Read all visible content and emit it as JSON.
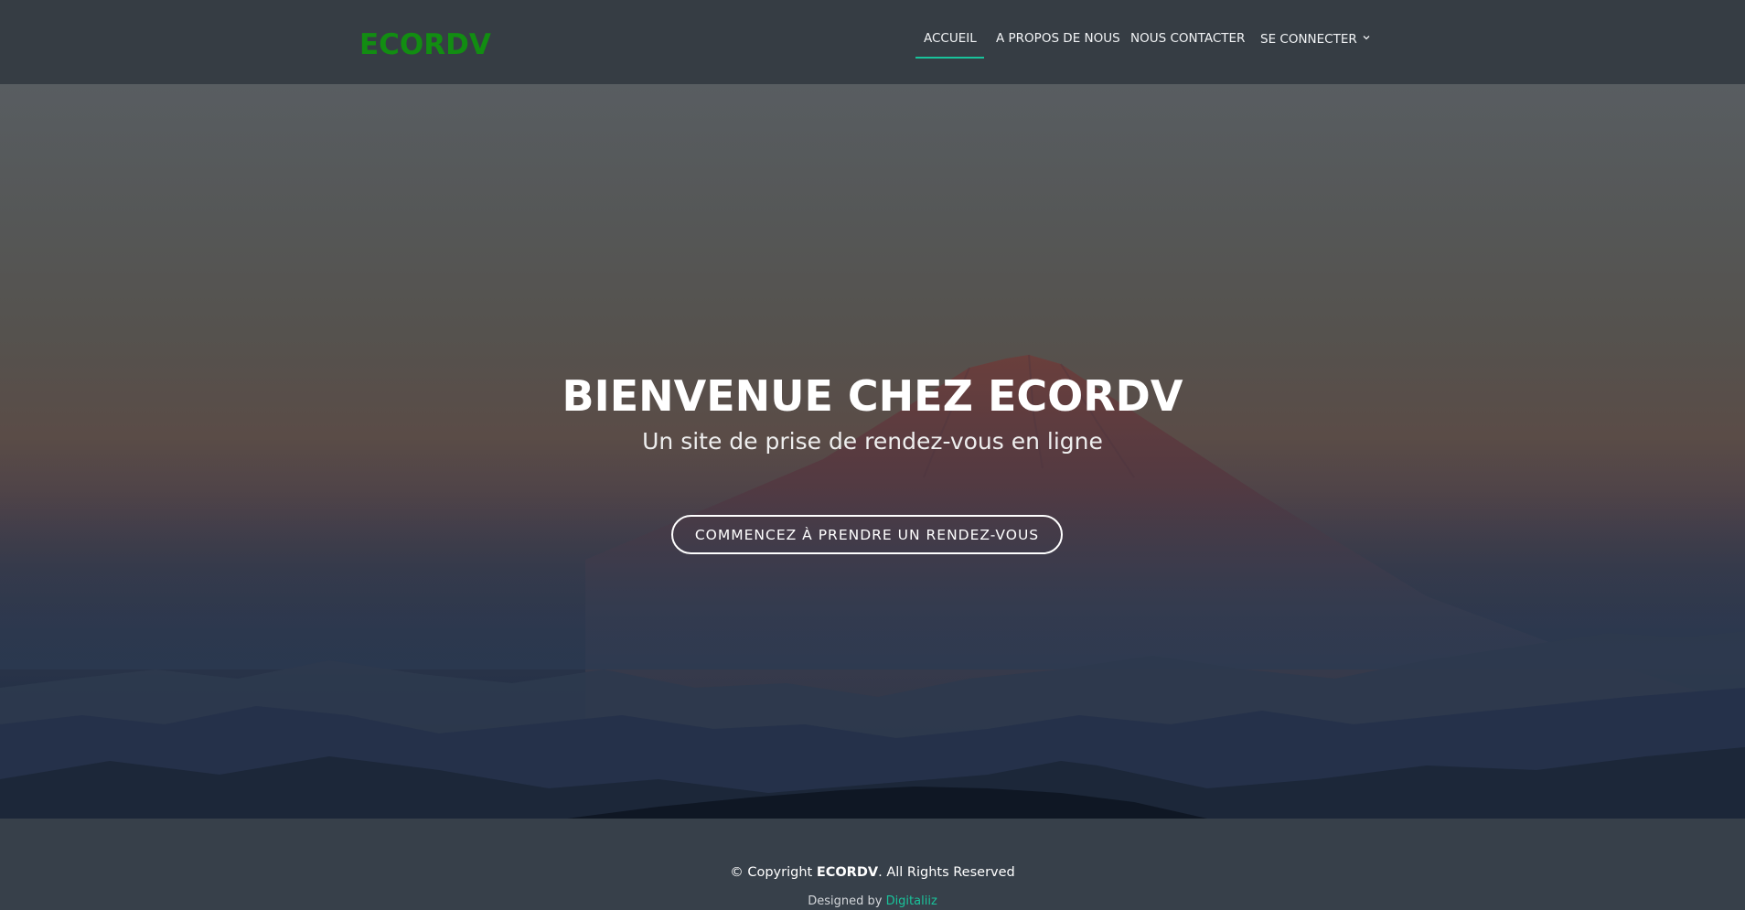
{
  "header": {
    "logo": "ECORDV",
    "nav": [
      {
        "label": "ACCUEIL",
        "active": true
      },
      {
        "label": "A PROPOS DE NOUS",
        "active": false
      },
      {
        "label": "NOUS CONTACTER",
        "active": false
      },
      {
        "label": "SE CONNECTER",
        "active": false,
        "icon": "chevron-down-icon"
      }
    ]
  },
  "hero": {
    "title": "BIENVENUE CHEZ ECORDV",
    "subtitle": "Un site de prise de rendez-vous en ligne",
    "cta_label": "COMMENCEZ À PRENDRE UN RENDEZ-VOUS"
  },
  "footer": {
    "copyright_prefix": "© Copyright ",
    "copyright_brand": "ECORDV",
    "copyright_suffix": ". All Rights Reserved",
    "designed_by_prefix": "Designed by ",
    "designed_by_link": "Digitaliiz"
  },
  "colors": {
    "logo": "#128d12",
    "accent": "#19c39b",
    "header_bg": "#363d44",
    "footer_bg": "#37404a"
  }
}
